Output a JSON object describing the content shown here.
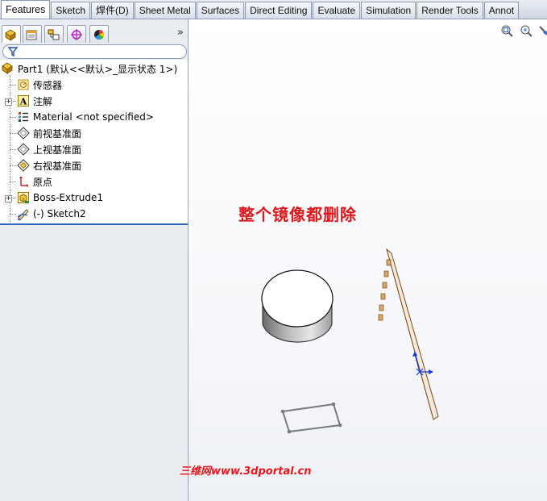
{
  "tabs": [
    {
      "label": "Features",
      "active": true
    },
    {
      "label": "Sketch"
    },
    {
      "label": "焊件(D)"
    },
    {
      "label": "Sheet Metal"
    },
    {
      "label": "Surfaces"
    },
    {
      "label": "Direct Editing"
    },
    {
      "label": "Evaluate"
    },
    {
      "label": "Simulation"
    },
    {
      "label": "Render Tools"
    },
    {
      "label": "Annot"
    }
  ],
  "pane": {
    "expand_glyph": "»",
    "toolbar_icons": [
      "feature-manager-icon",
      "property-manager-icon",
      "configuration-manager-icon",
      "dimxpert-manager-icon",
      "display-manager-icon"
    ]
  },
  "tree": {
    "root": "Part1  (默认<<默认>_显示状态 1>)",
    "items": [
      {
        "label": "传感器",
        "icon": "sensors-icon"
      },
      {
        "label": "注解",
        "icon": "annotations-icon"
      },
      {
        "label": "Material <not specified>",
        "icon": "material-icon"
      },
      {
        "label": "前视基准面",
        "icon": "front-plane-icon"
      },
      {
        "label": "上视基准面",
        "icon": "top-plane-icon"
      },
      {
        "label": "右视基准面",
        "icon": "right-plane-icon"
      },
      {
        "label": "原点",
        "icon": "origin-icon"
      },
      {
        "label": "Boss-Extrude1",
        "icon": "boss-extrude-icon"
      },
      {
        "label": "(-) Sketch2",
        "icon": "sketch-icon"
      }
    ]
  },
  "viewport": {
    "annotation": "整个镜像都删除",
    "watermark": "三维网www.3dportal.cn",
    "heads_up_icons": [
      "zoom-to-fit-icon",
      "zoom-area-icon",
      "previous-view-icon"
    ]
  },
  "colors": {
    "annotation": "#e0171d",
    "tree_accent": "#2f63b8",
    "body_edge": "#7a4a1a"
  }
}
